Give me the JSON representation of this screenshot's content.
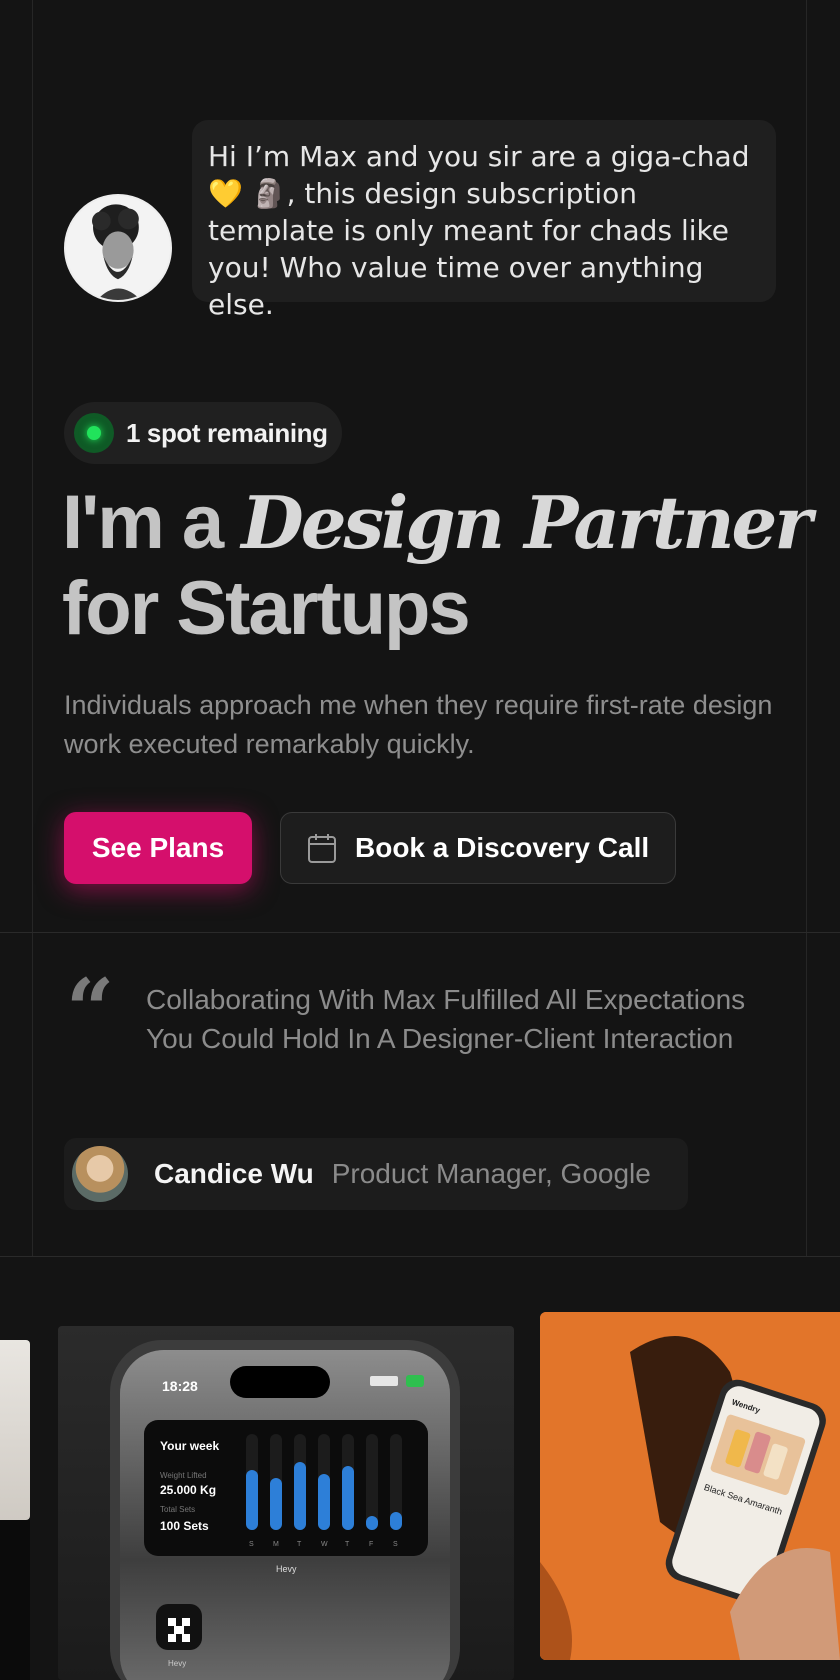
{
  "intro": {
    "message": "Hi I’m Max and you sir are a giga-chad 💛 🗿, this design subscription template is only meant for chads like you! Who value time over anything else."
  },
  "badge": {
    "text": "1 spot remaining"
  },
  "hero": {
    "title_plain": "I'm a ",
    "title_serif": "Design Partner",
    "title_line2": "for Startups",
    "subtitle": "Individuals approach me when they require first-rate design work executed remarkably quickly."
  },
  "buttons": {
    "primary": "See Plans",
    "secondary": "Book a Discovery Call"
  },
  "testimonial": {
    "quote": "Collaborating With Max Fulfilled All Expectations You Could Hold In A Designer-Client Interaction",
    "author_name": "Candice Wu",
    "author_role": "Product Manager, Google"
  },
  "gallery": {
    "phone": {
      "time": "18:28",
      "widget_title": "Your week",
      "weight_label": "Weight Lifted",
      "weight_value": "25.000 Kg",
      "sets_label": "Total Sets",
      "sets_value": "100 Sets",
      "days": [
        "S",
        "M",
        "T",
        "W",
        "T",
        "F",
        "S"
      ],
      "app_name": "Hevy",
      "icon_label": "Hevy"
    },
    "shop": {
      "brand": "Wendry",
      "product": "Black Sea Amaranth"
    }
  },
  "colors": {
    "accent": "#d50f6c",
    "status_green": "#21e35b",
    "background": "#141414"
  },
  "icons": {
    "calendar": "calendar-icon",
    "quote": "quote-icon",
    "status": "status-dot-icon"
  }
}
